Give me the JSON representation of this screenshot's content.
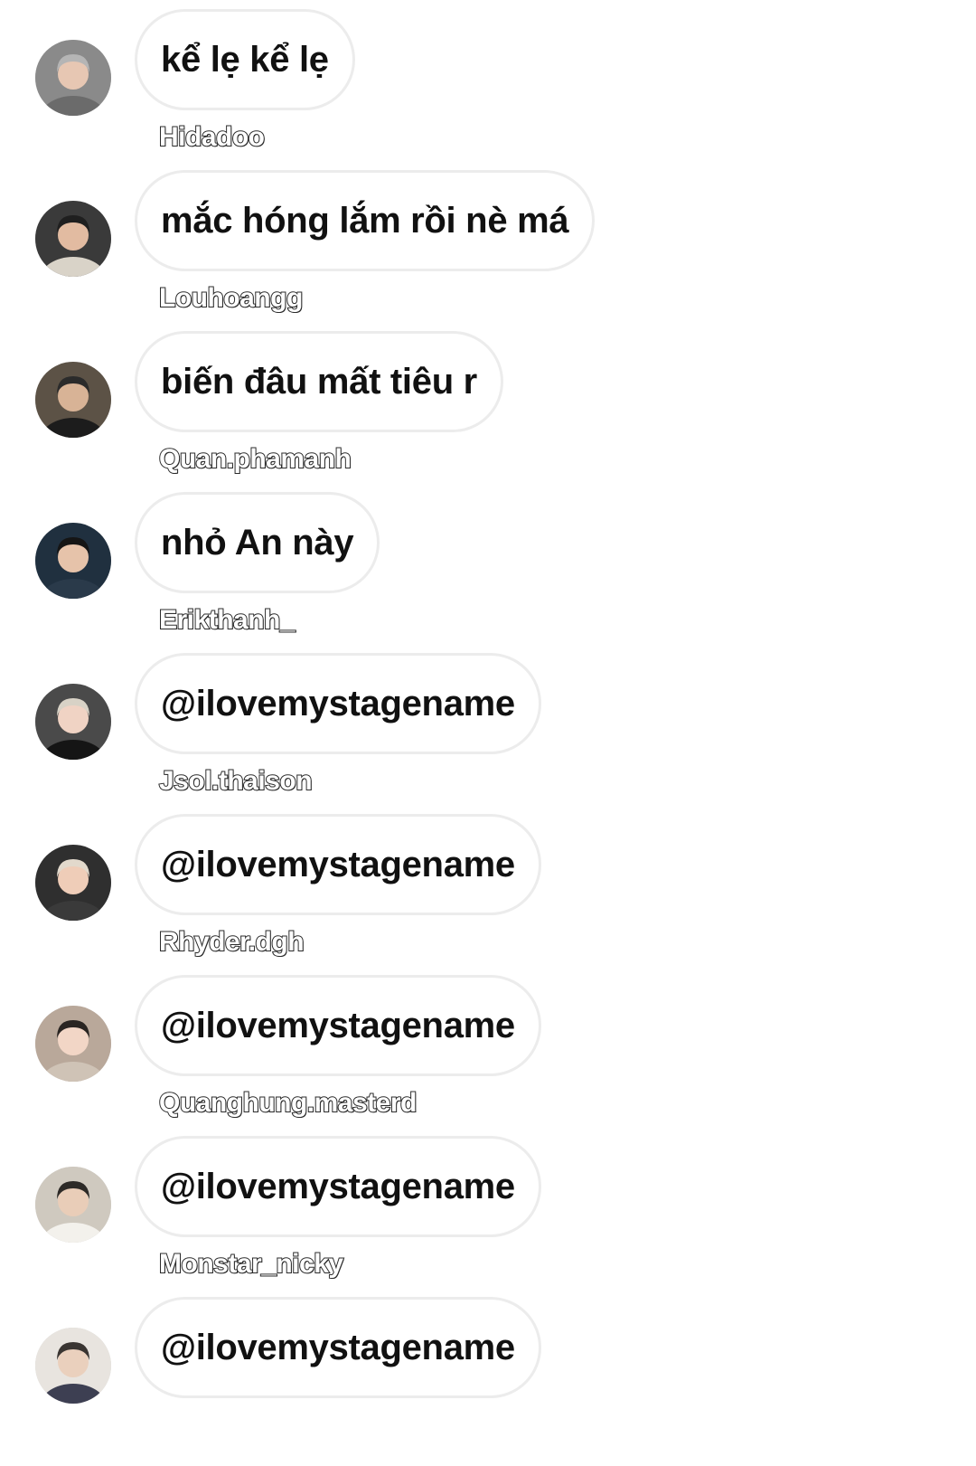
{
  "messages": [
    {
      "text": "kể lẹ kể lẹ",
      "sender": "Hidadoo",
      "avatar": {
        "icon": "avatar-photo-sunglasses",
        "bg": "#8a8a8a",
        "skin": "#e7c7b3",
        "hair": "#b5b5b5",
        "shirt": "#6b6b6b"
      }
    },
    {
      "text": "mắc hóng lắm rồi nè má",
      "sender": "Louhoangg",
      "avatar": {
        "icon": "avatar-photo-selfie",
        "bg": "#3a3a3a",
        "skin": "#e2bba1",
        "hair": "#1f1f1f",
        "shirt": "#d9d3c8"
      }
    },
    {
      "text": "biến đâu mất tiêu r",
      "sender": "Quan.phamanh",
      "avatar": {
        "icon": "avatar-photo",
        "bg": "#5c5246",
        "skin": "#d8b396",
        "hair": "#2b2b2b",
        "shirt": "#1c1c1c"
      }
    },
    {
      "text": "nhỏ An này",
      "sender": "Erikthanh_",
      "avatar": {
        "icon": "avatar-photo-cap",
        "bg": "#20303f",
        "skin": "#e6c3aa",
        "hair": "#151515",
        "shirt": "#2a3a4a"
      }
    },
    {
      "text": "@ilovemystagename",
      "sender": "Jsol.thaison",
      "avatar": {
        "icon": "avatar-photo-suit",
        "bg": "#4a4a4a",
        "skin": "#f0d3c4",
        "hair": "#d8d2c6",
        "shirt": "#151515"
      }
    },
    {
      "text": "@ilovemystagename",
      "sender": "Rhyder.dgh",
      "avatar": {
        "icon": "avatar-photo",
        "bg": "#2f2f2f",
        "skin": "#efcdb8",
        "hair": "#e2d9cc",
        "shirt": "#3a3a3a"
      }
    },
    {
      "text": "@ilovemystagename",
      "sender": "Quanghung.masterd",
      "avatar": {
        "icon": "avatar-photo",
        "bg": "#b9a89a",
        "skin": "#f2d6c6",
        "hair": "#2a2522",
        "shirt": "#cfc3b6"
      }
    },
    {
      "text": "@ilovemystagename",
      "sender": "Monstar_nicky",
      "avatar": {
        "icon": "avatar-photo-mirror",
        "bg": "#cfc9bf",
        "skin": "#e9cdb8",
        "hair": "#2d2a27",
        "shirt": "#f3f1ec"
      }
    },
    {
      "text": "@ilovemystagename",
      "sender": "",
      "avatar": {
        "icon": "avatar-photo",
        "bg": "#e8e4df",
        "skin": "#ead0bd",
        "hair": "#3a3532",
        "shirt": "#3d3f52"
      }
    }
  ]
}
